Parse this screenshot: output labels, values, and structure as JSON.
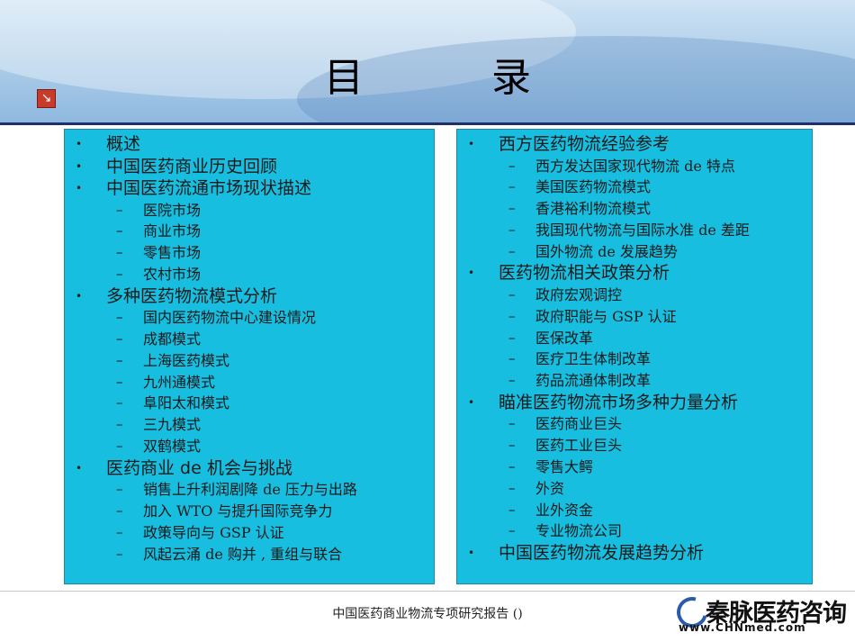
{
  "title": {
    "part1": "目",
    "part2": "录"
  },
  "nav_icon": "back-arrow-icon",
  "left_column": [
    {
      "level": 1,
      "text": "概述"
    },
    {
      "level": 1,
      "text": "中国医药商业历史回顾"
    },
    {
      "level": 1,
      "text": "中国医药流通市场现状描述"
    },
    {
      "level": 2,
      "text": "医院市场"
    },
    {
      "level": 2,
      "text": "商业市场"
    },
    {
      "level": 2,
      "text": "零售市场"
    },
    {
      "level": 2,
      "text": "农村市场"
    },
    {
      "level": 1,
      "text": "多种医药物流模式分析"
    },
    {
      "level": 2,
      "text": "国内医药物流中心建设情况"
    },
    {
      "level": 2,
      "text": "成都模式"
    },
    {
      "level": 2,
      "text": "上海医药模式"
    },
    {
      "level": 2,
      "text": "九州通模式"
    },
    {
      "level": 2,
      "text": "阜阳太和模式"
    },
    {
      "level": 2,
      "text": "三九模式"
    },
    {
      "level": 2,
      "text": "双鹤模式"
    },
    {
      "level": 1,
      "text": "医药商业 de 机会与挑战"
    },
    {
      "level": 2,
      "text": "销售上升利润剧降 de 压力与出路"
    },
    {
      "level": 2,
      "text": "加入 WTO 与提升国际竞争力"
    },
    {
      "level": 2,
      "text": "政策导向与 GSP 认证"
    },
    {
      "level": 2,
      "text": "风起云涌 de 购并 , 重组与联合"
    }
  ],
  "right_column": [
    {
      "level": 1,
      "text": "西方医药物流经验参考"
    },
    {
      "level": 2,
      "text": "西方发达国家现代物流 de 特点"
    },
    {
      "level": 2,
      "text": "美国医药物流模式"
    },
    {
      "level": 2,
      "text": "香港裕利物流模式"
    },
    {
      "level": 2,
      "text": "我国现代物流与国际水准 de 差距"
    },
    {
      "level": 2,
      "text": "国外物流 de 发展趋势"
    },
    {
      "level": 1,
      "text": "医药物流相关政策分析"
    },
    {
      "level": 2,
      "text": "政府宏观调控"
    },
    {
      "level": 2,
      "text": "政府职能与 GSP 认证"
    },
    {
      "level": 2,
      "text": "医保改革"
    },
    {
      "level": 2,
      "text": "医疗卫生体制改革"
    },
    {
      "level": 2,
      "text": "药品流通体制改革"
    },
    {
      "level": 1,
      "text": "瞄准医药物流市场多种力量分析"
    },
    {
      "level": 2,
      "text": "医药商业巨头"
    },
    {
      "level": 2,
      "text": "医药工业巨头"
    },
    {
      "level": 2,
      "text": "零售大鳄"
    },
    {
      "level": 2,
      "text": "外资"
    },
    {
      "level": 2,
      "text": "业外资金"
    },
    {
      "level": 2,
      "text": "专业物流公司"
    },
    {
      "level": 1,
      "text": "中国医药物流发展趋势分析"
    }
  ],
  "bullet_glyph": "•",
  "dash_glyph": "–",
  "footer": {
    "text": "中国医药商业物流专项研究报告 ()"
  },
  "logo": {
    "name": "秦脉医药咨询",
    "url": "www.CHNmed.com"
  },
  "colors": {
    "panel": "#18bee0",
    "header_rule": "#1f2f6a",
    "icon": "#c83a2a"
  }
}
